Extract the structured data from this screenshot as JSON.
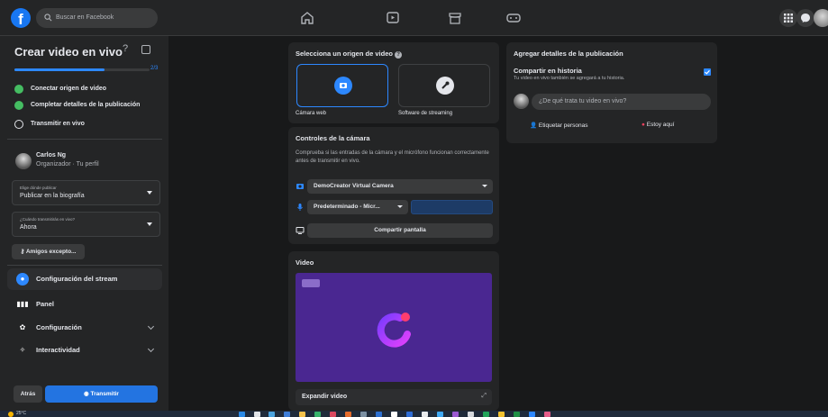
{
  "topbar": {
    "logo": "f",
    "search_placeholder": "Buscar en Facebook",
    "nav_icons": [
      "home-icon",
      "watch-icon",
      "marketplace-icon",
      "gaming-icon"
    ],
    "right_icons": [
      "menu-grid-icon",
      "messenger-icon",
      "notifications-icon"
    ]
  },
  "left": {
    "title": "Crear video en vivo",
    "help": "?",
    "progress": {
      "label": "2/3",
      "fraction": 0.667
    },
    "steps": [
      {
        "label": "Conectar origen de video",
        "done": true
      },
      {
        "label": "Completar detalles de la publicación",
        "done": true
      },
      {
        "label": "Transmitir en vivo",
        "done": false
      }
    ],
    "profile": {
      "name": "Carlos Ng",
      "subtitle": "Organizador · Tu perfil"
    },
    "where": {
      "label": "Elige dónde publicar",
      "value": "Publicar en la biografía"
    },
    "when": {
      "label": "¿Cuándo transmitirás en vivo?",
      "value": "Ahora"
    },
    "audience": "Amigos excepto...",
    "menu": [
      {
        "label": "Configuración del stream",
        "active": true,
        "chevron": false
      },
      {
        "label": "Panel",
        "active": false,
        "chevron": false
      },
      {
        "label": "Configuración",
        "active": false,
        "chevron": true
      },
      {
        "label": "Interactividad",
        "active": false,
        "chevron": true
      }
    ],
    "back_label": "Atrás",
    "golive_label": "Transmitir"
  },
  "source": {
    "title": "Selecciona un origen de video",
    "options": [
      {
        "label": "Cámara web",
        "selected": true
      },
      {
        "label": "Software de streaming",
        "selected": false
      }
    ]
  },
  "controls": {
    "title": "Controles de la cámara",
    "description": "Comprueba si las entradas de la cámara y el micrófono funcionan correctamente antes de transmitir en vivo.",
    "camera": "DemoCreator Virtual Camera",
    "mic": "Predeterminado - Micr...",
    "share_label": "Compartir pantalla"
  },
  "video": {
    "title": "Video",
    "expand_label": "Expandir video"
  },
  "details": {
    "title": "Agregar detalles de la publicación",
    "story_title": "Compartir en historia",
    "story_sub": "Tu video en vivo también se agregará a tu historia.",
    "story_checked": true,
    "input_placeholder": "¿De qué trata tu video en vivo?",
    "tag_label": "Etiquetar personas",
    "checkin_label": "Estoy aquí"
  },
  "taskbar": {
    "temp": "25°C"
  },
  "colors": {
    "accent": "#2d88ff",
    "done": "#45bd62",
    "video_bg": "#4a2791"
  }
}
